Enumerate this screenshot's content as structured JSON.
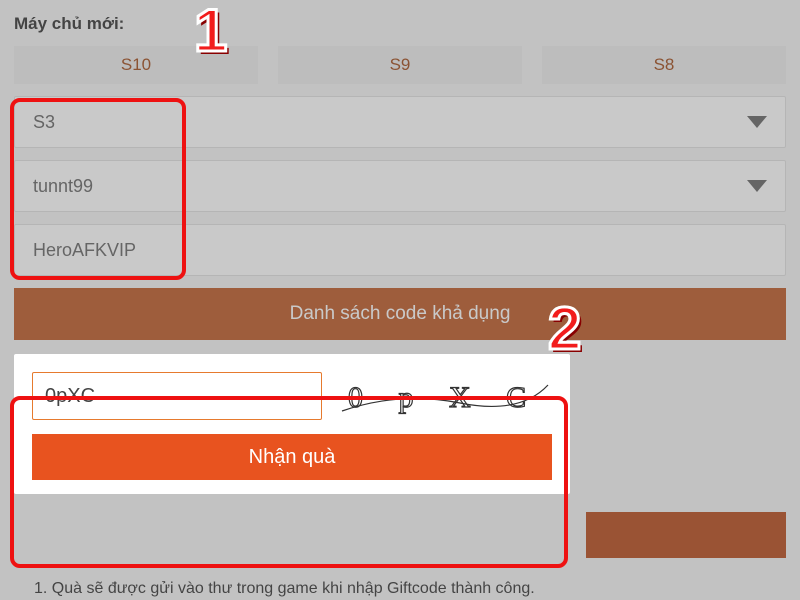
{
  "heading": "Máy chủ mới:",
  "servers": {
    "a": "S10",
    "b": "S9",
    "c": "S8"
  },
  "fields": {
    "server_select": "S3",
    "account_select": "tunnt99",
    "character": "HeroAFKVIP"
  },
  "buttons": {
    "code_list": "Danh sách code khả dụng",
    "submit": "Nhận quà"
  },
  "captcha": {
    "input_value": "0pXC",
    "image_text": "0 p X C"
  },
  "note": "1. Quà sẽ được gửi vào thư trong game khi nhập Giftcode thành công.",
  "markers": {
    "one": "1",
    "two": "2"
  },
  "colors": {
    "accent": "#e8531f",
    "accent_dark": "#be5a27"
  }
}
